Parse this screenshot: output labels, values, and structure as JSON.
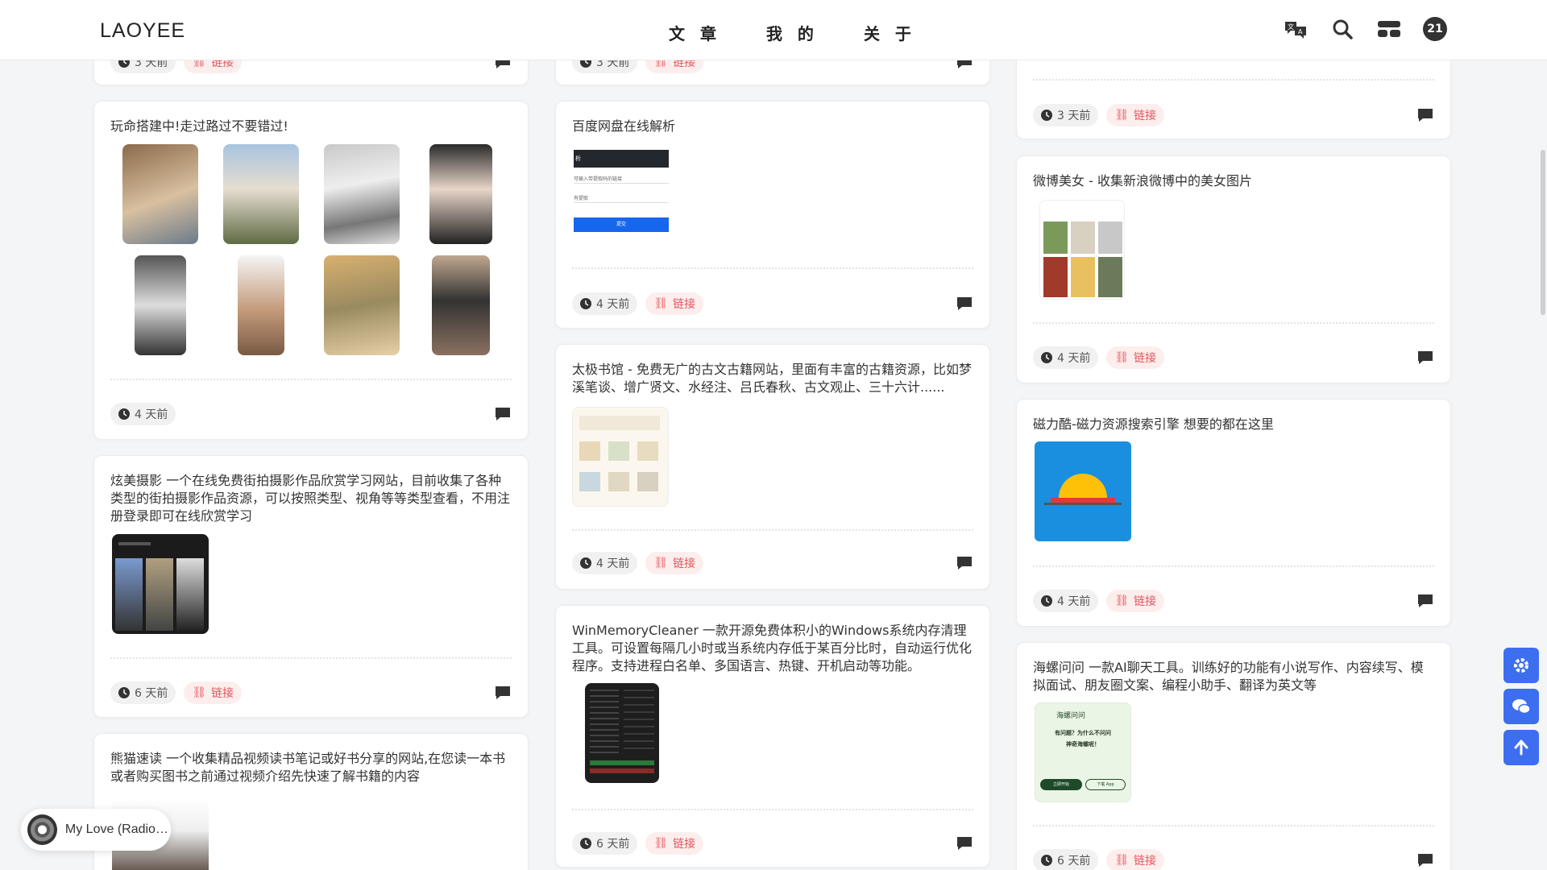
{
  "header": {
    "logo": "LAOYEE",
    "nav": [
      "文 章",
      "我 的",
      "关 于"
    ],
    "badge_count": "21"
  },
  "common": {
    "link_label": "链接",
    "time_partial": "3 天前"
  },
  "col1": {
    "card_a": {
      "title": "玩命搭建中!走过路过不要错过!",
      "time": "4 天前"
    },
    "card_b": {
      "title": "炫美摄影 一个在线免费街拍摄影作品欣赏学习网站，目前收集了各种类型的街拍摄影作品资源，可以按照类型、视角等等类型查看，不用注册登录即可在线欣赏学习",
      "time": "6 天前",
      "link": "链接"
    },
    "card_c": {
      "title": "熊猫速读 一个收集精品视频读书笔记或好书分享的网站,在您读一本书或者购买图书之前通过视频介绍先快速了解书籍的内容"
    }
  },
  "col2": {
    "card_a": {
      "title": "百度网盘在线解析",
      "time": "4 天前",
      "link": "链接",
      "shot": {
        "header_text": "析",
        "input1": "可输入带提取码的链接",
        "input2": "有提取",
        "button": "提交"
      }
    },
    "card_b": {
      "title": "太极书馆 - 免费无广的古文古籍网站，里面有丰富的古籍资源，比如梦溪笔谈、增广贤文、水经注、吕氏春秋、古文观止、三十六计......",
      "time": "4 天前",
      "link": "链接"
    },
    "card_c": {
      "title": "WinMemoryCleaner 一款开源免费体积小的Windows系统内存清理工具。可设置每隔几小时或当系统内存低于某百分比时，自动运行优化程序。支持进程白名单、多国语言、热键、开机启动等功能。",
      "time": "6 天前",
      "link": "链接"
    }
  },
  "col3": {
    "card_top": {
      "time": "3 天前",
      "link": "链接"
    },
    "card_a": {
      "title": "微博美女 - 收集新浪微博中的美女图片",
      "time": "4 天前",
      "link": "链接"
    },
    "card_b": {
      "title": "磁力酷-磁力资源搜索引擎 想要的都在这里",
      "time": "4 天前",
      "link": "链接"
    },
    "card_c": {
      "title": "海螺问问 一款AI聊天工具。训练好的功能有小说写作、内容续写、模拟面试、朋友圈文案、编程小助手、翻译为英文等",
      "time": "6 天前",
      "link": "链接",
      "shot": {
        "brand": "海螺问问",
        "line1": "有问题？为什么不问问",
        "line2": "神奇海螺呢！",
        "btn1": "立即开始",
        "btn2": "下载 App"
      }
    }
  },
  "player": {
    "track": "My Love (Radio Edit)"
  },
  "colors": {
    "accent": "#3d6ef0",
    "link_red": "#e5545a",
    "link_bg": "#fdeeee"
  }
}
